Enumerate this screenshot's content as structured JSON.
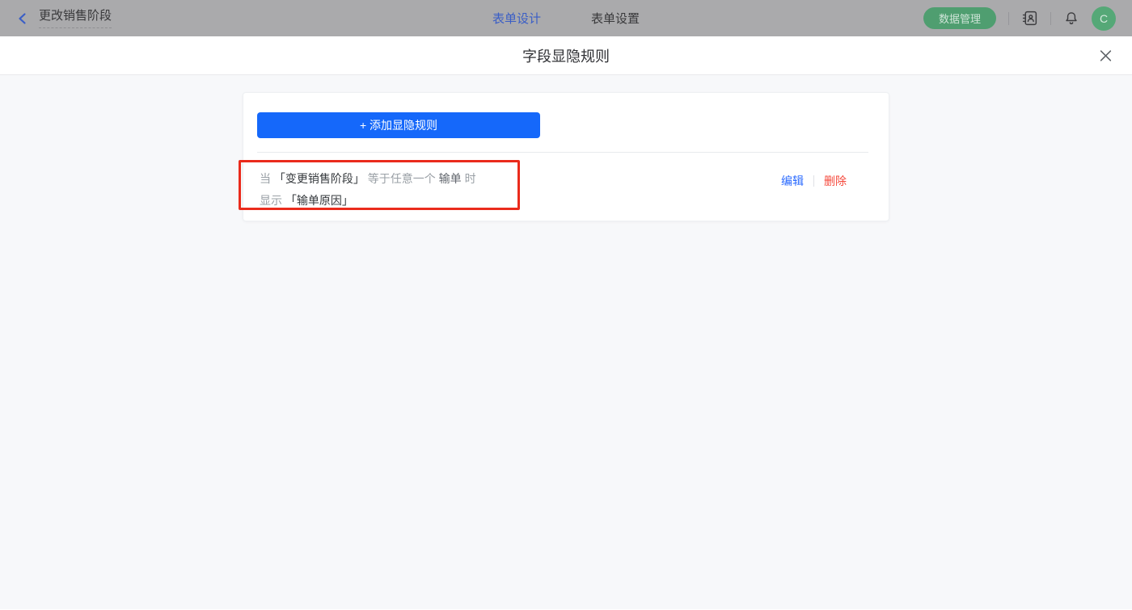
{
  "topbar": {
    "back_label": "更改销售阶段",
    "tabs": [
      {
        "label": "表单设计",
        "active": true
      },
      {
        "label": "表单设置",
        "active": false
      }
    ],
    "data_manage_label": "数据管理",
    "avatar_letter": "C",
    "icons": {
      "back": "chevron-left-icon",
      "contacts": "address-book-icon",
      "notifications": "bell-icon"
    }
  },
  "modal": {
    "title": "字段显隐规则",
    "close_icon": "close-icon",
    "add_rule_button": {
      "plus": "+",
      "label": "添加显隐规则"
    },
    "rule": {
      "when_prefix": "当",
      "field": "「变更销售阶段」",
      "condition": "等于任意一个",
      "value": "输单",
      "time_suffix": "时",
      "show_prefix": "显示",
      "show_field": "「输单原因」",
      "edit_label": "编辑",
      "delete_label": "删除"
    }
  },
  "colors": {
    "accent_blue": "#1568fa",
    "link_blue": "#2a6aff",
    "delete_red": "#f5483b",
    "highlight_red": "#ea2b1c",
    "green_button": "#4f9e70",
    "avatar_green": "#55a877",
    "topbar_bg": "#aaaaac",
    "topbar_text": "#39393b",
    "topbar_blue": "#3a5ec6",
    "body_bg": "#f7f8fa"
  }
}
